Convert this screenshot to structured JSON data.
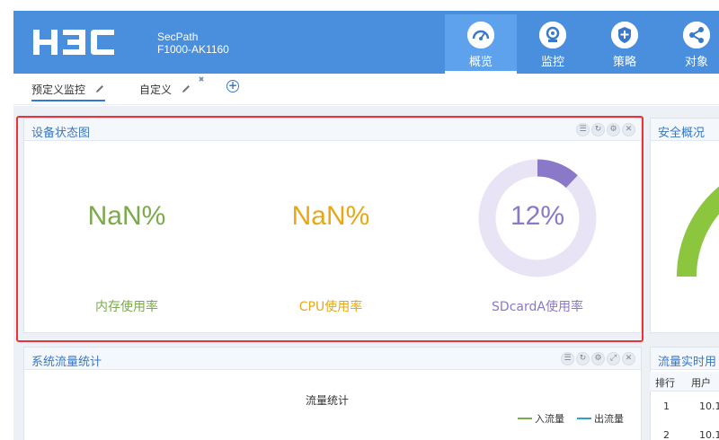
{
  "header": {
    "brand": "H3C",
    "model_line1": "SecPath",
    "model_line2": "F1000-AK1160",
    "nav": [
      {
        "label": "概览",
        "icon": "dashboard-gauge-icon",
        "active": true
      },
      {
        "label": "监控",
        "icon": "webcam-icon",
        "active": false
      },
      {
        "label": "策略",
        "icon": "shield-plus-icon",
        "active": false
      },
      {
        "label": "对象",
        "icon": "share-nodes-icon",
        "active": false
      }
    ],
    "colors": {
      "bar": "#4a8fdd",
      "active": "#5ea2ee"
    }
  },
  "tabs": [
    {
      "label": "预定义监控",
      "active": true
    },
    {
      "label": "自定义",
      "active": false
    }
  ],
  "tab_close_glyph": "✖",
  "tab_add_glyph": "+",
  "device_panel": {
    "title": "设备状态图",
    "metrics": [
      {
        "value": "NaN%",
        "label": "内存使用率",
        "color": "#7aaa4a"
      },
      {
        "value": "NaN%",
        "label": "CPU使用率",
        "color": "#e6a817"
      },
      {
        "value": "12%",
        "label": "SDcardA使用率",
        "color": "#8a78c8",
        "fraction": 0.12,
        "track": "#e8e4f6"
      }
    ]
  },
  "security_panel": {
    "title": "安全概况",
    "gauge_color": "#8cc63f"
  },
  "traffic_panel": {
    "title": "系统流量统计",
    "chart_title": "流量统计",
    "legend": [
      {
        "name": "入流量",
        "color": "#7aaa4a"
      },
      {
        "name": "出流量",
        "color": "#2aa3d6"
      }
    ]
  },
  "realtime_panel": {
    "title": "流量实时用",
    "columns": [
      "排行",
      "用户"
    ],
    "rows": [
      {
        "rank": "1",
        "user": "10.1"
      },
      {
        "rank": "2",
        "user": "10.1"
      }
    ]
  }
}
